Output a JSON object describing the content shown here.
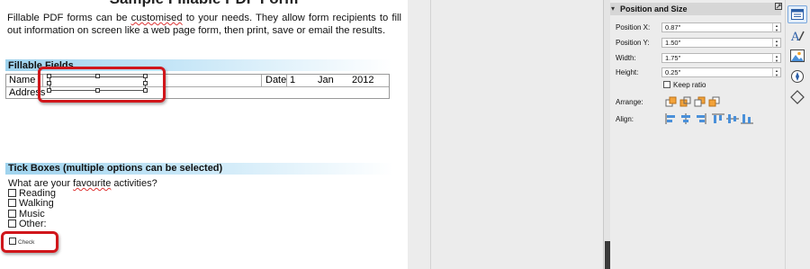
{
  "document": {
    "title": "Sample Fillable PDF Form",
    "intro_parts": [
      "Fillable PDF forms can be ",
      "customised",
      " to your needs. They allow form recipients to fill out information on screen like a web page form, then print, save or email the results."
    ],
    "fillable_heading": "Fillable Fields",
    "row1": {
      "name_label": "Name",
      "date_label": "Date",
      "day": "1",
      "month": "Jan",
      "year": "2012"
    },
    "row2": {
      "address_label": "Address"
    },
    "ticks_heading": "Tick Boxes (multiple options can be selected)",
    "question_parts": [
      "What are your ",
      "favourite",
      " activities?"
    ],
    "options": [
      "Reading",
      "Walking",
      "Music",
      "Other:"
    ],
    "check_label": "Check"
  },
  "sidebar": {
    "deck_title": "Position and Size",
    "fields": {
      "position_x": {
        "label": "Position X:",
        "value": "0.87\""
      },
      "position_y": {
        "label": "Position Y:",
        "value": "1.50\""
      },
      "width": {
        "label": "Width:",
        "value": "1.75\""
      },
      "height": {
        "label": "Height:",
        "value": "0.25\""
      }
    },
    "keep_ratio": {
      "label": "Keep ratio",
      "checked": false
    },
    "arrange_label": "Arrange:",
    "align_label": "Align:"
  },
  "icons": {
    "collapse": "chevron-down-icon",
    "more": "more-options-icon",
    "tabs": [
      "properties-icon",
      "styles-icon",
      "gallery-icon",
      "navigator-icon",
      "shapes-icon"
    ]
  },
  "colors": {
    "accent_red": "#d0161b",
    "band_blue": "#9fd3ee",
    "active_tab": "#e3eefa"
  }
}
